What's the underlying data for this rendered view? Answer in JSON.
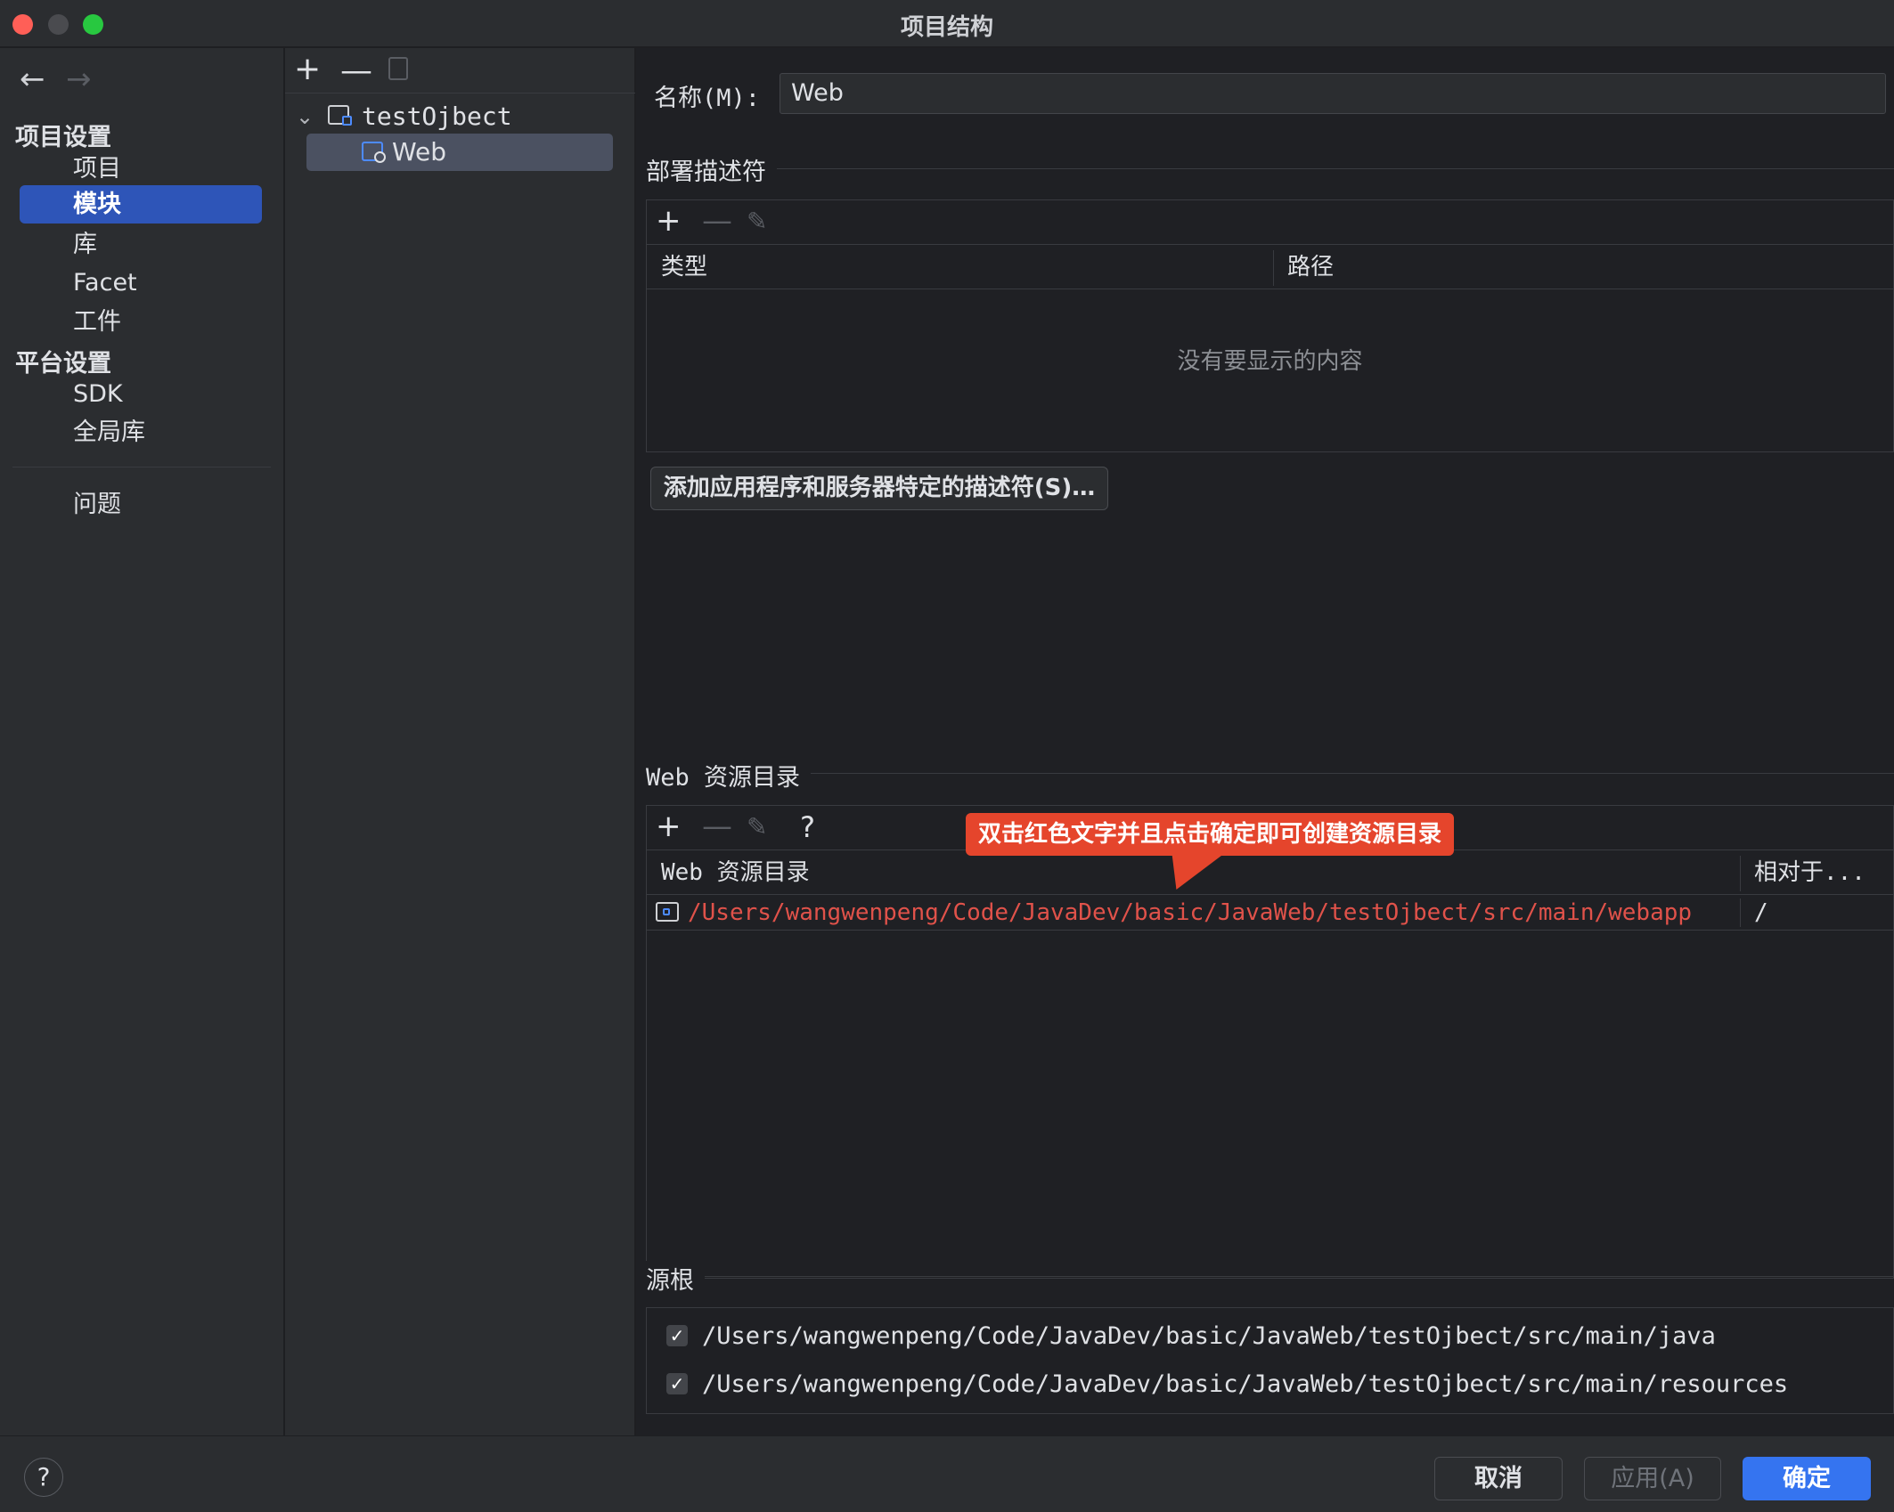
{
  "window": {
    "title": "项目结构"
  },
  "sidebar": {
    "groups": [
      "项目设置",
      "平台设置"
    ],
    "items": [
      "项目",
      "模块",
      "库",
      "Facet",
      "工件",
      "SDK",
      "全局库",
      "问题"
    ]
  },
  "tree": {
    "root": "testOjbect",
    "child": "Web"
  },
  "content": {
    "name_label": "名称(M):",
    "name_value": "Web",
    "deploy_section": "部署描述符",
    "deploy_cols": [
      "类型",
      "路径"
    ],
    "deploy_empty": "没有要显示的内容",
    "add_descriptor_button": "添加应用程序和服务器特定的描述符(S)…",
    "web_res_section": "Web 资源目录",
    "web_res_cols": [
      "Web 资源目录",
      "相对于..."
    ],
    "web_res_rows": [
      {
        "path": "/Users/wangwenpeng/Code/JavaDev/basic/JavaWeb/testOjbect/src/main/webapp",
        "relative": "/"
      }
    ],
    "callout": "双击红色文字并且点击确定即可创建资源目录",
    "source_roots_section": "源根",
    "source_roots": [
      "/Users/wangwenpeng/Code/JavaDev/basic/JavaWeb/testOjbect/src/main/java",
      "/Users/wangwenpeng/Code/JavaDev/basic/JavaWeb/testOjbect/src/main/resources"
    ]
  },
  "footer": {
    "help": "?",
    "cancel": "取消",
    "apply": "应用(A)",
    "ok": "确定"
  },
  "icons": {
    "add": "+",
    "remove": "—",
    "help": "?"
  }
}
